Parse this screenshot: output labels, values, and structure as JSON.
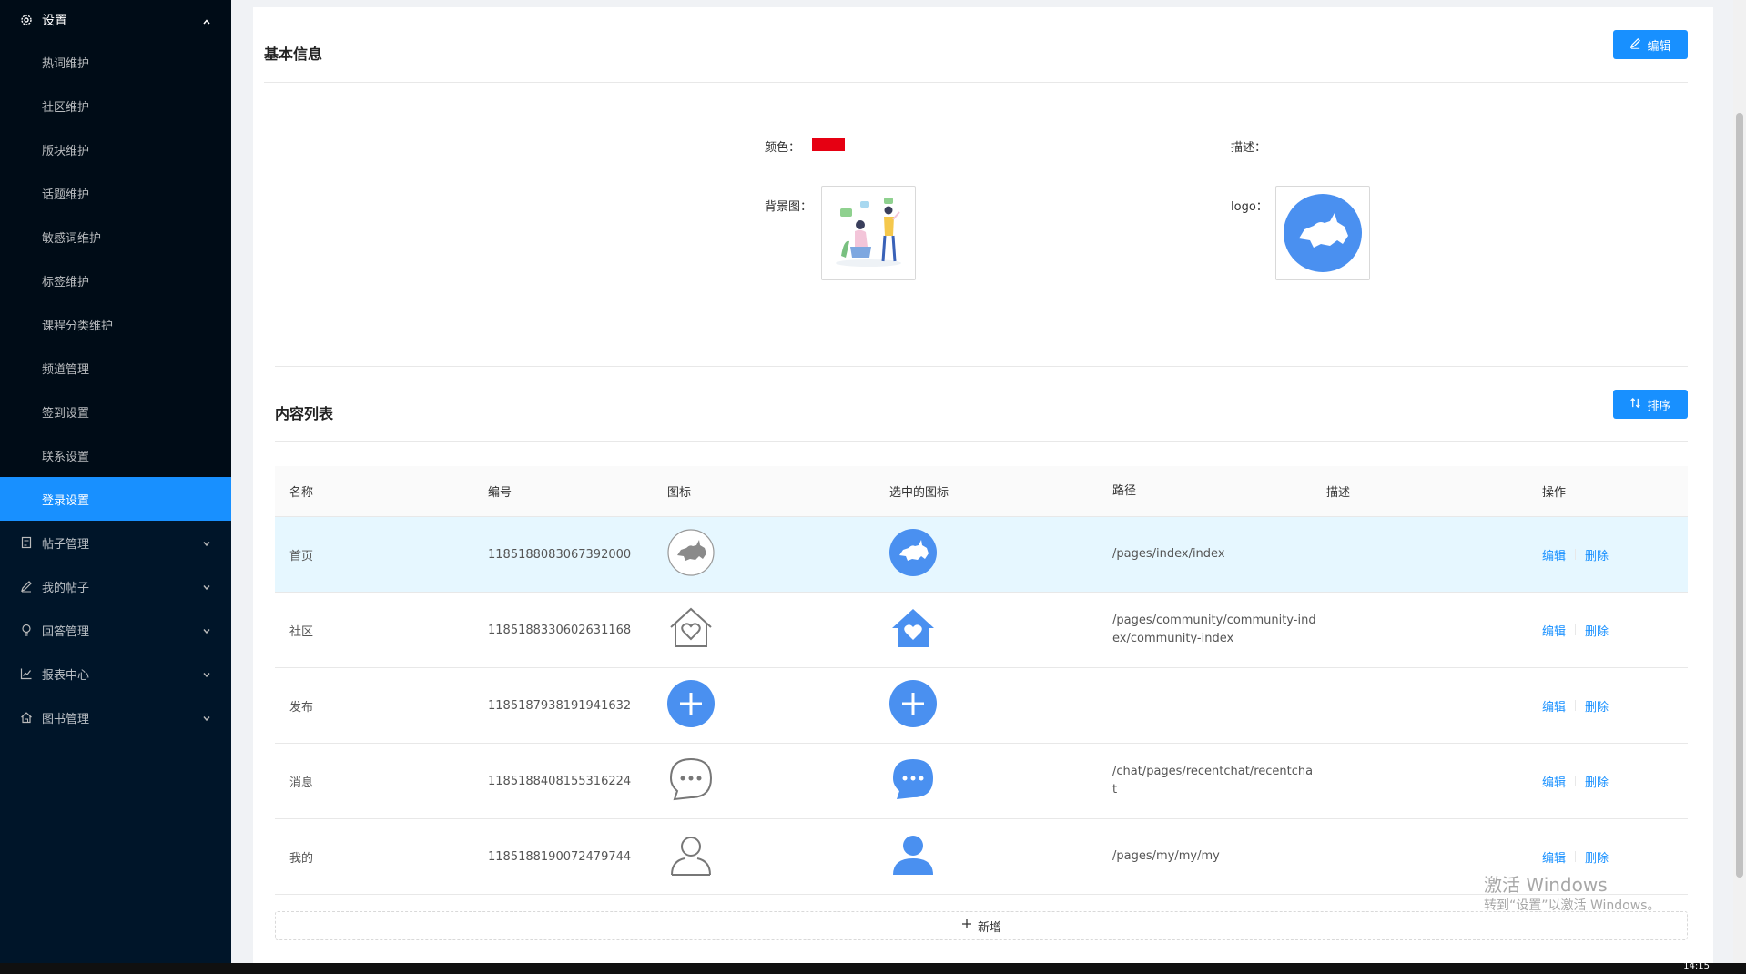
{
  "sidebar": {
    "group_label": "设置",
    "sub_items": [
      "热词维护",
      "社区维护",
      "版块维护",
      "话题维护",
      "敏感词维护",
      "标签维护",
      "课程分类维护",
      "频道管理",
      "签到设置",
      "联系设置",
      "登录设置"
    ],
    "active_sub_index": 10,
    "top_items": [
      {
        "label": "帖子管理",
        "icon": "file-icon"
      },
      {
        "label": "我的帖子",
        "icon": "edit-icon"
      },
      {
        "label": "回答管理",
        "icon": "bulb-icon"
      },
      {
        "label": "报表中心",
        "icon": "line-chart-icon"
      },
      {
        "label": "图书管理",
        "icon": "home-icon"
      }
    ]
  },
  "basic_info": {
    "title": "基本信息",
    "edit_label": "编辑",
    "color_label": "颜色：",
    "color_value": "#e60012",
    "desc_label": "描述：",
    "bg_label": "背景图：",
    "logo_label": "logo："
  },
  "content_list": {
    "title": "内容列表",
    "sort_label": "排序",
    "columns": [
      "名称",
      "编号",
      "图标",
      "选中的图标",
      "路径",
      "描述",
      "操作"
    ],
    "rows": [
      {
        "name": "首页",
        "id": "1185188083067392000",
        "icon": "rhino-icon",
        "path": "/pages/index/index",
        "desc": ""
      },
      {
        "name": "社区",
        "id": "1185188330602631168",
        "icon": "house-heart-icon",
        "path": "/pages/community/community-index/community-index",
        "desc": ""
      },
      {
        "name": "发布",
        "id": "1185187938191941632",
        "icon": "plus-circle-icon",
        "path": "",
        "desc": ""
      },
      {
        "name": "消息",
        "id": "1185188408155316224",
        "icon": "chat-bubble-icon",
        "path": "/chat/pages/recentchat/recentchat",
        "desc": ""
      },
      {
        "name": "我的",
        "id": "1185188190072479744",
        "icon": "user-icon",
        "path": "/pages/my/my/my",
        "desc": ""
      }
    ],
    "op_edit": "编辑",
    "op_delete": "删除",
    "add_label": "新增"
  },
  "watermark": {
    "line1": "激活 Windows",
    "line2": "转到“设置”以激活 Windows。"
  },
  "taskbar": {
    "clock": "14:15"
  },
  "colors": {
    "primary": "#1890ff",
    "sidebar_bg": "#001529",
    "icon_blue": "#4a90f0"
  }
}
